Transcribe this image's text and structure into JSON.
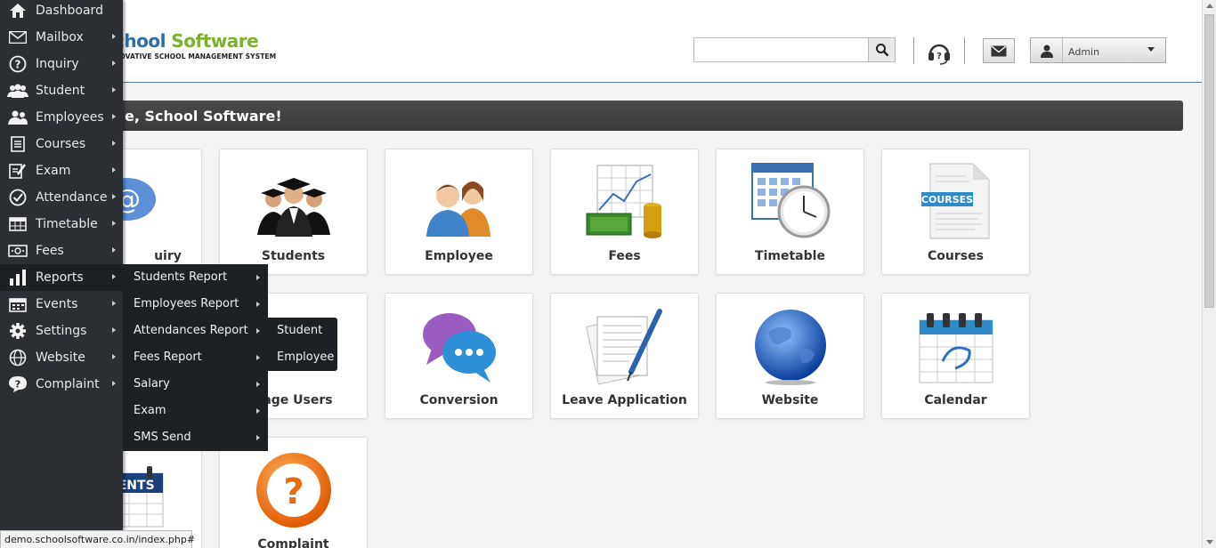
{
  "header": {
    "logo_title_prefix": "chool",
    "logo_title_suffix": "Software",
    "logo_tagline": "NOVATIVE SCHOOL MANAGEMENT SYSTEM",
    "search_placeholder": "",
    "user_name": "Admin"
  },
  "welcome": {
    "text": "e, School Software!"
  },
  "sidebar": {
    "items": [
      {
        "label": "Dashboard",
        "icon": "home-icon"
      },
      {
        "label": "Mailbox",
        "icon": "mail-icon"
      },
      {
        "label": "Inquiry",
        "icon": "question-icon"
      },
      {
        "label": "Student",
        "icon": "users-icon"
      },
      {
        "label": "Employees",
        "icon": "employees-icon"
      },
      {
        "label": "Courses",
        "icon": "document-icon"
      },
      {
        "label": "Exam",
        "icon": "edit-icon"
      },
      {
        "label": "Attendance",
        "icon": "check-icon"
      },
      {
        "label": "Timetable",
        "icon": "table-icon"
      },
      {
        "label": "Fees",
        "icon": "money-icon"
      },
      {
        "label": "Reports",
        "icon": "bar-chart-icon"
      },
      {
        "label": "Events",
        "icon": "calendar-icon"
      },
      {
        "label": "Settings",
        "icon": "gear-icon"
      },
      {
        "label": "Website",
        "icon": "globe-icon"
      },
      {
        "label": "Complaint",
        "icon": "help-icon"
      }
    ]
  },
  "reports_submenu": {
    "items": [
      {
        "label": "Students Report"
      },
      {
        "label": "Employees Report"
      },
      {
        "label": "Attendances Report"
      },
      {
        "label": "Fees Report"
      },
      {
        "label": "Salary"
      },
      {
        "label": "Exam"
      },
      {
        "label": "SMS Send"
      }
    ]
  },
  "attendance_submenu": {
    "items": [
      {
        "label": "Student"
      },
      {
        "label": "Employee"
      }
    ]
  },
  "tiles": {
    "inquiry": "uiry",
    "students": "Students",
    "employee": "Employee",
    "fees": "Fees",
    "timetable": "Timetable",
    "courses": "Courses",
    "events": "E",
    "manage_users": "nage Users",
    "conversion": "Conversion",
    "leave": "Leave Application",
    "website": "Website",
    "calendar": "Calendar",
    "complaint": "Complaint",
    "courses_badge": "COURSES",
    "events_badge": "EVENTS"
  },
  "status": {
    "url": "demo.schoolsoftware.co.in/index.php#"
  },
  "colors": {
    "sidebar_bg": "#2b2f33",
    "submenu_bg": "#1e2124",
    "logo_blue": "#2e6fa7",
    "logo_green": "#7cb130"
  }
}
